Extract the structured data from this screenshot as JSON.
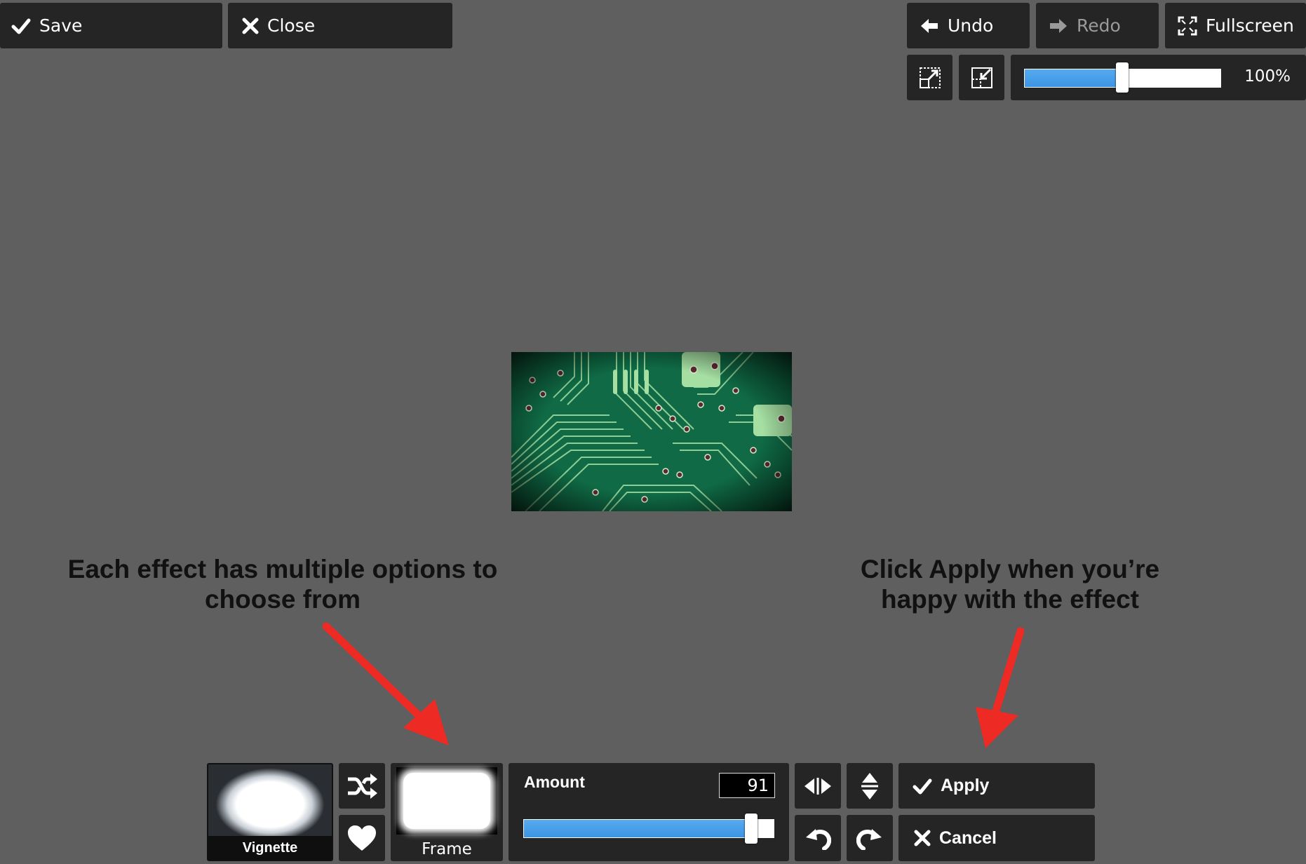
{
  "toolbar": {
    "save_label": "Save",
    "close_label": "Close",
    "undo_label": "Undo",
    "redo_label": "Redo",
    "fullscreen_label": "Fullscreen"
  },
  "zoom": {
    "value": 1.0,
    "label": "100%"
  },
  "annotations": {
    "left_line1": "Each effect has multiple options to",
    "left_line2": "choose from",
    "right_line1": "Click Apply when you’re",
    "right_line2": "happy with the effect"
  },
  "effects": {
    "vignette_label": "Vignette",
    "frame_label": "Frame",
    "amount_label": "Amount",
    "amount_value": "91",
    "amount_fraction": 0.91,
    "apply_label": "Apply",
    "cancel_label": "Cancel"
  },
  "colors": {
    "accent": "#4aa0eb",
    "panel": "#252525",
    "background": "#5f5f5f",
    "annotation_arrow": "#ee2a24"
  },
  "icons": [
    "check-icon",
    "close-icon",
    "arrow-left-icon",
    "arrow-right-icon",
    "fullscreen-icon",
    "expand-icon",
    "shrink-icon",
    "shuffle-icon",
    "heart-icon",
    "flip-horizontal-icon",
    "flip-vertical-icon",
    "rotate-left-icon",
    "rotate-right-icon"
  ]
}
